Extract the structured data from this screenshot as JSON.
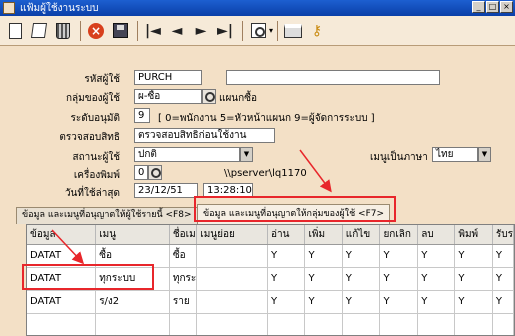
{
  "window": {
    "title": "แฟ้มผู้ใช้งานระบบ",
    "controls": [
      "_",
      "□",
      "×"
    ]
  },
  "toolbar": {
    "buttons": [
      "new-icon",
      "edit-icon",
      "delete-icon",
      "cancel-icon",
      "save-icon",
      "first-icon",
      "prev-icon",
      "next-icon",
      "last-icon",
      "find-icon",
      "print-icon",
      "key-icon"
    ],
    "glyphs": {
      "first": "|◄",
      "prev": "◄",
      "next": "►",
      "last": "►|",
      "stop": "×",
      "key": "⚷",
      "caret": "▾"
    }
  },
  "form": {
    "user_code_label": "รหัสผู้ใช้",
    "user_code_value": "PURCH",
    "user_name_value": "",
    "group_label": "กลุ่มของผู้ใช้",
    "group_value": "ผ-ซื้อ",
    "group_desc": "แผนกซื้อ",
    "level_label": "ระดับอนุมัติ",
    "level_value": "9",
    "level_hint": "[ 0=พนักงาน 5=หัวหน้าแผนก 9=ผู้จัดการระบบ ]",
    "permission_label": "ตรวจสอบสิทธิ",
    "permission_value": "ตรวจสอบสิทธิก่อนใช้งาน",
    "status_label": "สถานะผู้ใช้",
    "status_value": "ปกติ",
    "menu_lang_label": "เมนูเป็นภาษา",
    "menu_lang_value": "ไทย",
    "printer_label": "เครื่องพิมพ์",
    "printer_value": "0",
    "printer_path": "\\\\pserver\\lq1170",
    "last_used_label": "วันที่ใช้ล่าสุด",
    "last_used_date": "23/12/51",
    "last_used_time": "13:28:10"
  },
  "tabs": {
    "tab_user": "ข้อมูล และเมนูที่อนุญาตให้ผู้ใช้รายนี้  <F8>",
    "tab_group": "ข้อมูล และเมนูที่อนุญาตให้กลุ่มของผู้ใช้  <F7>"
  },
  "grid": {
    "columns": [
      "ข้อมูล",
      "เมนู",
      "ชื่อเม",
      "เมนูย่อย",
      "อ่าน",
      "เพิ่ม",
      "แก้ไข",
      "ยกเลิก",
      "ลบ",
      "พิมพ์",
      "รับร"
    ],
    "rows": [
      [
        "DATAT",
        "ซื้อ",
        "ซื้อ",
        "",
        "Y",
        "Y",
        "Y",
        "Y",
        "Y",
        "Y",
        "Y"
      ],
      [
        "DATAT",
        "ทุกระบบ",
        "ทุกระ",
        "",
        "Y",
        "Y",
        "Y",
        "Y",
        "Y",
        "Y",
        "Y"
      ],
      [
        "DATAT",
        "ร/ง2",
        "ราย",
        "",
        "Y",
        "Y",
        "Y",
        "Y",
        "Y",
        "Y",
        "Y"
      ]
    ]
  },
  "colors": {
    "form_bg": "#f3e0c6",
    "annotation": "#e8262b",
    "titlebar": "#0a3fa8"
  }
}
